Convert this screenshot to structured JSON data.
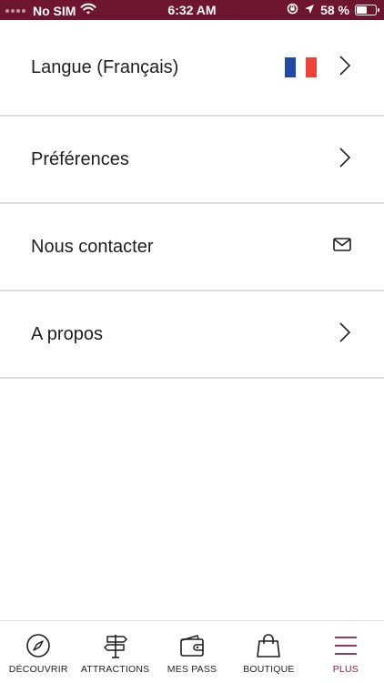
{
  "status_bar": {
    "carrier": "No SIM",
    "time": "6:32 AM",
    "battery_percent": "58 %",
    "battery_level": 0.58
  },
  "menu": {
    "items": [
      {
        "label": "Langue (Français)",
        "trailing_icon": "chevron-right-icon",
        "flag": "france-flag"
      },
      {
        "label": "Préférences",
        "trailing_icon": "chevron-right-icon"
      },
      {
        "label": "Nous contacter",
        "trailing_icon": "envelope-icon"
      },
      {
        "label": "A propos",
        "trailing_icon": "chevron-right-icon"
      }
    ]
  },
  "tab_bar": {
    "active": "PLUS",
    "tabs": [
      {
        "label": "DÉCOUVRIR",
        "icon": "compass-icon"
      },
      {
        "label": "ATTRACTIONS",
        "icon": "signpost-icon"
      },
      {
        "label": "MES PASS",
        "icon": "wallet-icon"
      },
      {
        "label": "BOUTIQUE",
        "icon": "shopping-bag-icon"
      },
      {
        "label": "PLUS",
        "icon": "menu-icon"
      }
    ]
  },
  "colors": {
    "status_bar_bg": "#6e1530",
    "accent": "#8a1c45",
    "flag_blue": "#1f4aa8",
    "flag_red": "#ef4135"
  }
}
